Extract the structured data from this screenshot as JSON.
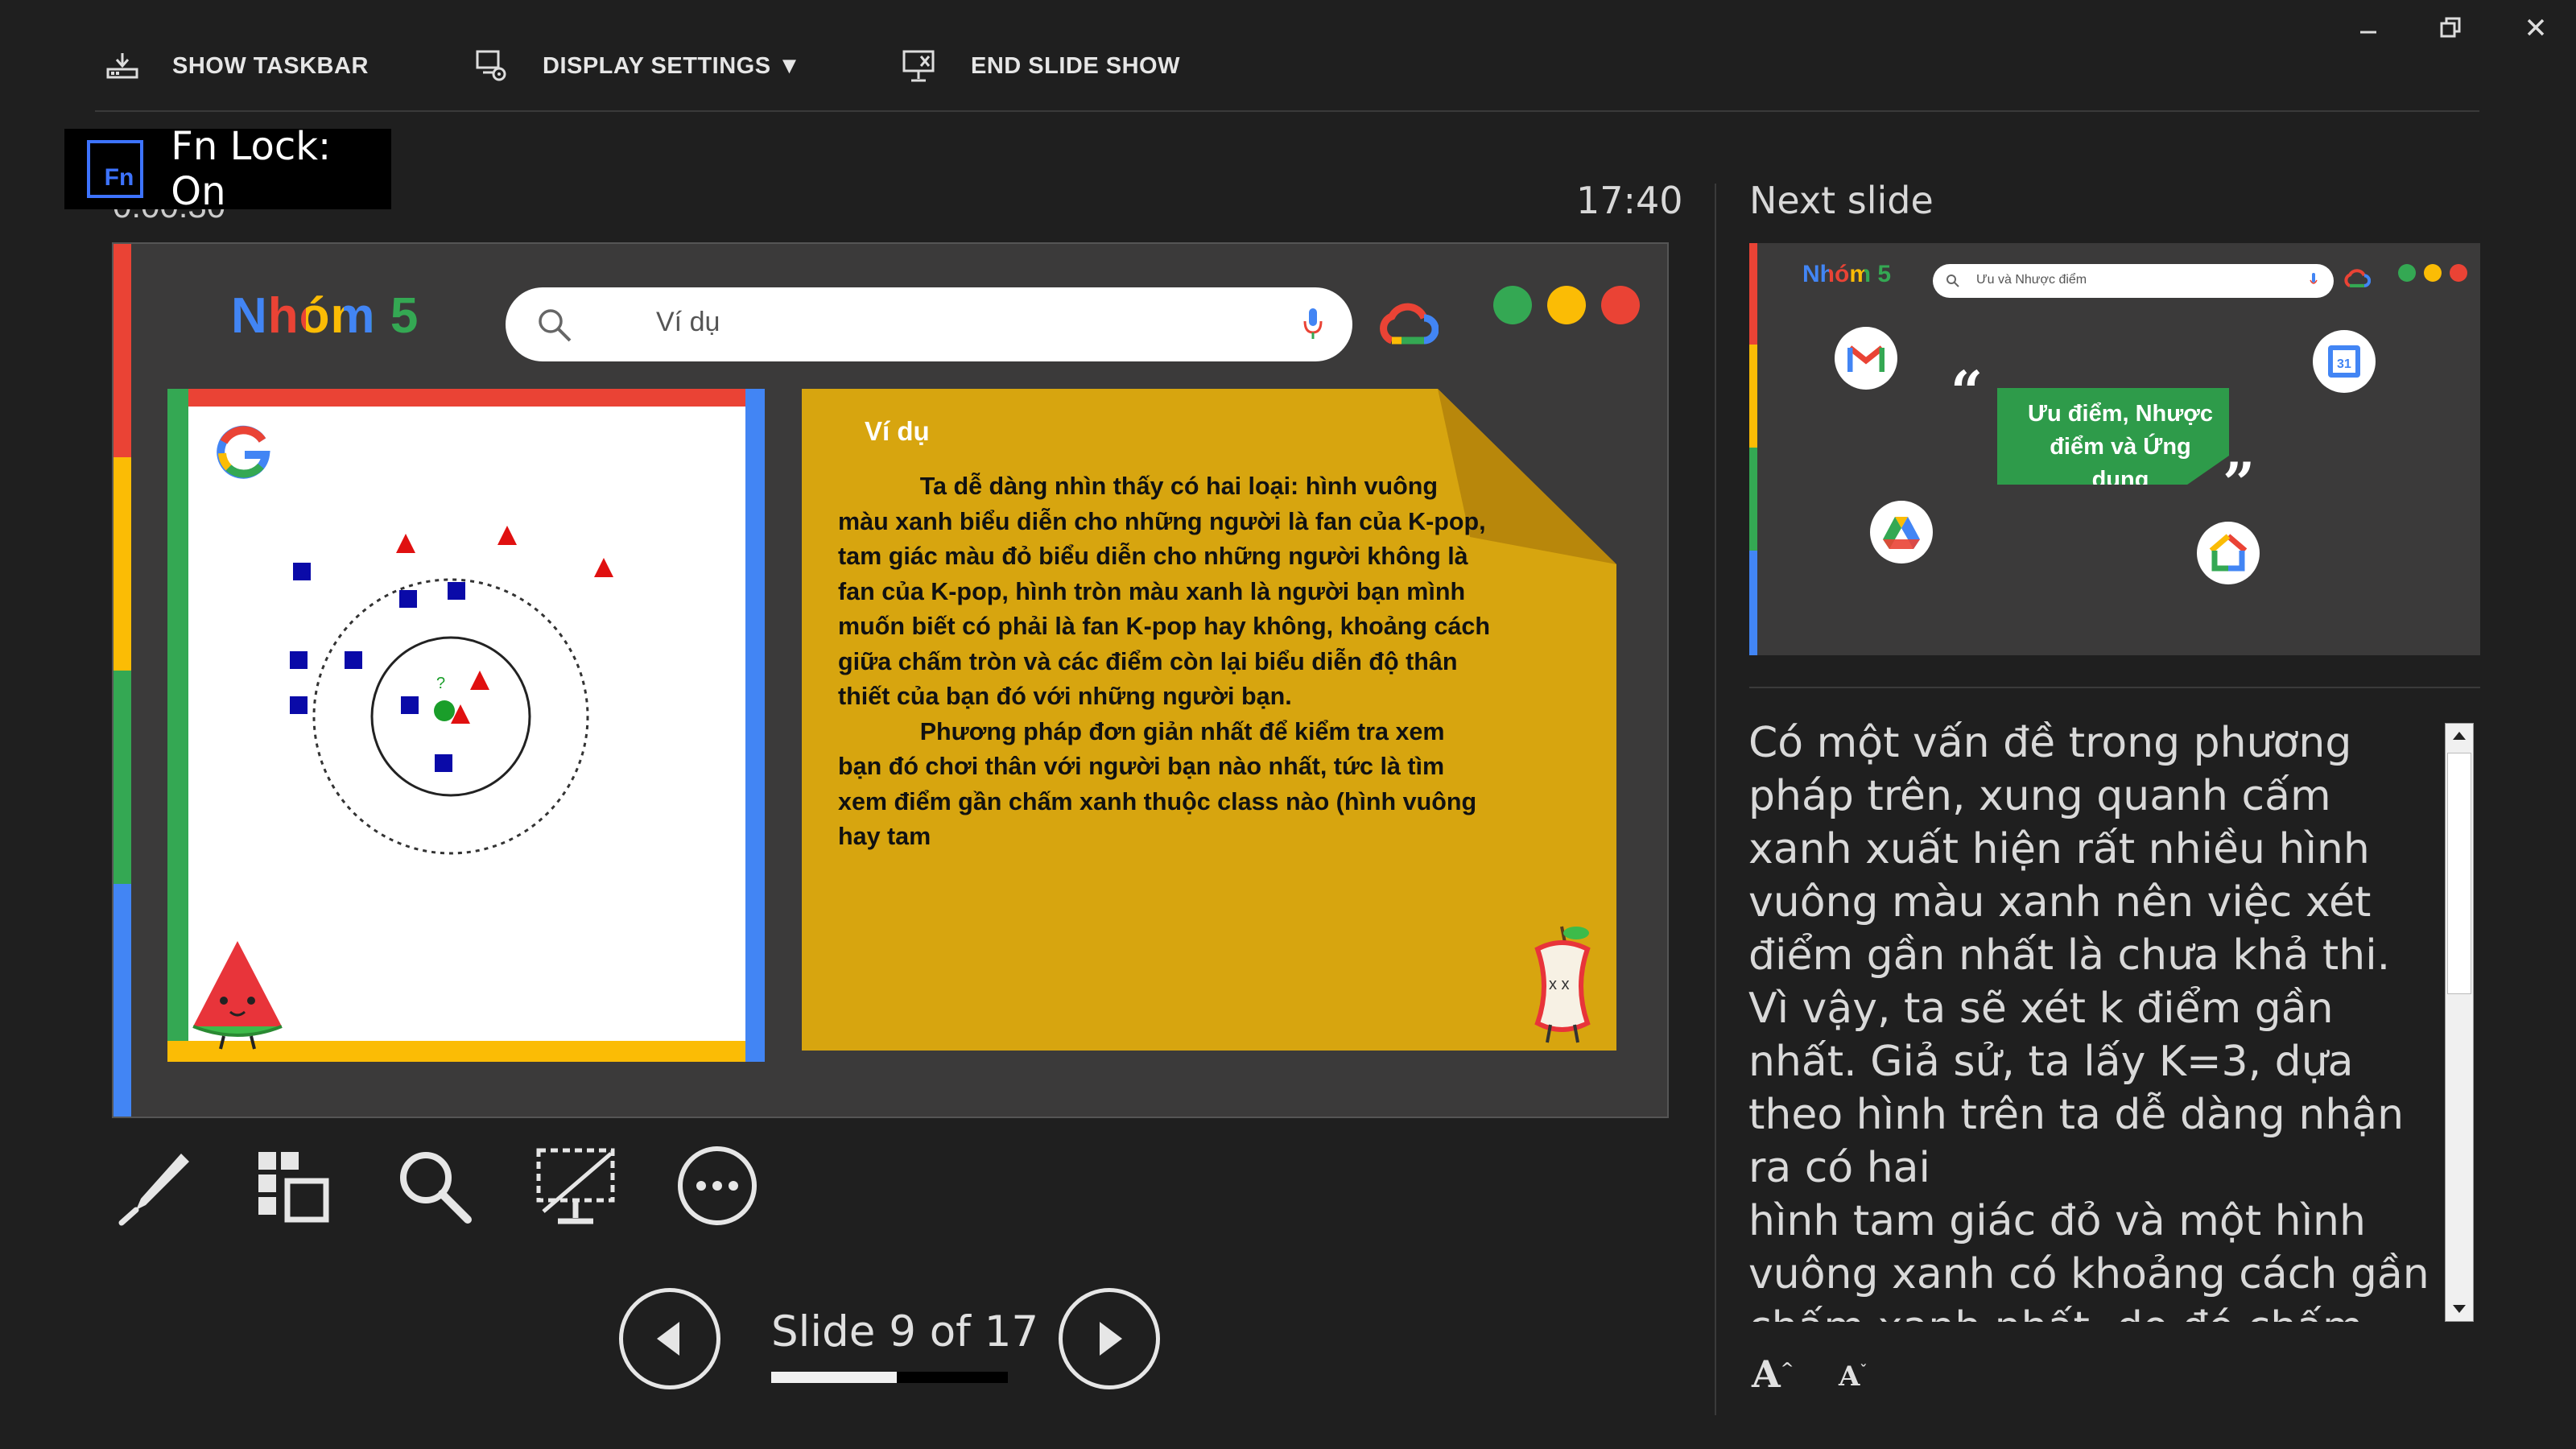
{
  "toolbar": {
    "show_taskbar": "SHOW TASKBAR",
    "display_settings": "DISPLAY SETTINGS ▼",
    "end_slide_show": "END SLIDE SHOW"
  },
  "fn_lock": {
    "badge": "Fn",
    "text": "Fn Lock: On"
  },
  "timer_partial": "0:00:30",
  "clock": "17:40",
  "current_slide": {
    "group_title": "Nhóm 5",
    "search_text": "Ví dụ",
    "note_title": "Ví dụ",
    "note_body": "            Ta dễ dàng nhìn thấy có hai loại: hình vuông màu xanh biểu diễn cho những người là fan của K-pop, tam giác màu đỏ biểu diễn cho những người không là fan của K-pop, hình tròn màu xanh là người bạn mình muốn biết có phải là fan K-pop hay không, khoảng cách giữa chấm tròn và các điểm còn lại biểu diễn độ thân thiết của bạn đó với những người bạn.\n            Phương pháp đơn giản nhất để kiểm tra xem bạn đó chơi thân với người bạn nào nhất, tức là tìm xem điểm gần chấm xanh thuộc class nào (hình vuông hay tam",
    "colors": {
      "red": "#ea4335",
      "yellow": "#fbbc05",
      "green": "#34a853",
      "blue": "#4285f4",
      "note": "#d7a50f"
    }
  },
  "slide_nav": {
    "counter": "Slide 9 of 17",
    "current": 9,
    "total": 17
  },
  "next_slide": {
    "label": "Next slide",
    "group_title": "Nhóm 5",
    "search_text": "Ưu và Nhược điểm",
    "banner": "Ưu điểm, Nhược điểm và Ứng dụng"
  },
  "notes": "Có một vấn đề trong phương pháp trên, xung quanh cấm xanh xuất hiện rất nhiều hình vuông màu xanh nên việc xét điểm gần nhất là chưa khả thi. Vì vậy, ta sẽ xét k điểm gần nhất. Giả sử, ta lấy K=3, dựa theo hình trên ta dễ dàng nhận ra có hai\nhình tam giác đỏ và một hình vuông xanh có khoảng cách gần chấm xanh nhất, do đó chấm xanh được phân vào lớp tam",
  "font_buttons": {
    "bigger": "A",
    "smaller": "A"
  },
  "icons": [
    "taskbar-icon",
    "display-settings-icon",
    "end-show-icon",
    "minimize-icon",
    "restore-icon",
    "close-icon",
    "pen-icon",
    "slides-grid-icon",
    "zoom-icon",
    "black-screen-icon",
    "more-icon",
    "prev-icon",
    "next-icon"
  ]
}
